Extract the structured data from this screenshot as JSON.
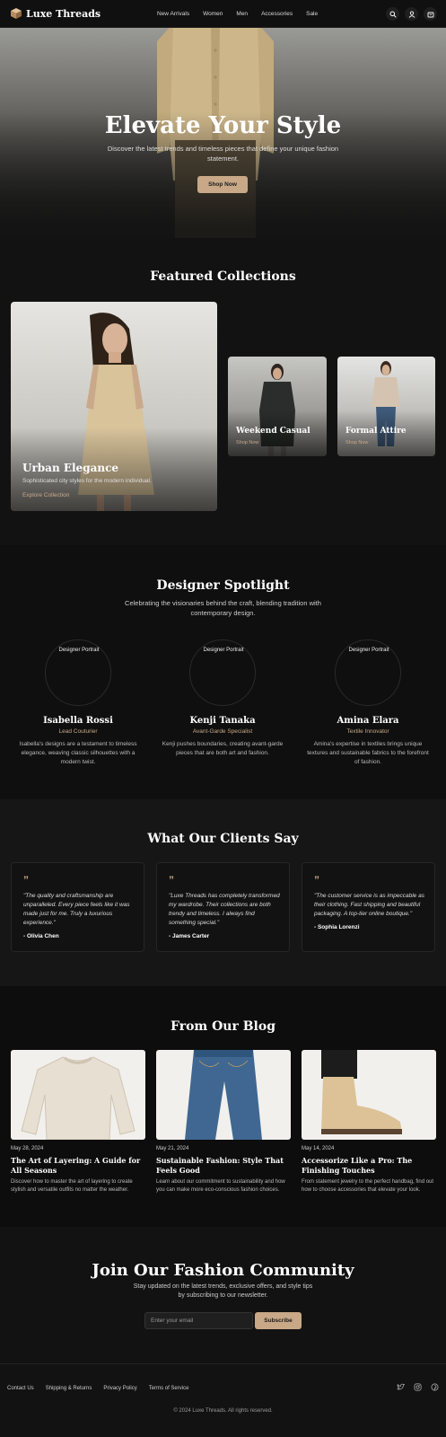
{
  "header": {
    "brand": "Luxe Threads",
    "nav": [
      "New Arrivals",
      "Women",
      "Men",
      "Accessories",
      "Sale"
    ],
    "icons": [
      "search-icon",
      "user-icon",
      "cart-icon"
    ]
  },
  "hero": {
    "title": "Elevate Your Style",
    "subtitle": "Discover the latest trends and timeless pieces that define your unique fashion statement.",
    "cta": "Shop Now"
  },
  "featured": {
    "title": "Featured Collections",
    "cards": [
      {
        "title": "Urban Elegance",
        "subtitle": "Sophisticated city styles for the modern individual.",
        "link": "Explore Collection"
      },
      {
        "title": "Weekend Casual",
        "link": "Shop Now"
      },
      {
        "title": "Formal Attire",
        "link": "Shop Now"
      }
    ]
  },
  "designers": {
    "title": "Designer Spotlight",
    "subtitle": "Celebrating the visionaries behind the craft, blending tradition with contemporary design.",
    "portrait_alt": "Designer Portrait",
    "people": [
      {
        "name": "Isabella Rossi",
        "role": "Lead Couturier",
        "bio": "Isabella's designs are a testament to timeless elegance, weaving classic silhouettes with a modern twist."
      },
      {
        "name": "Kenji Tanaka",
        "role": "Avant-Garde Specialist",
        "bio": "Kenji pushes boundaries, creating avant-garde pieces that are both art and fashion."
      },
      {
        "name": "Amina Elara",
        "role": "Textile Innovator",
        "bio": "Amina's expertise in textiles brings unique textures and sustainable fabrics to the forefront of fashion."
      }
    ]
  },
  "testimonials": {
    "title": "What Our Clients Say",
    "items": [
      {
        "quote": "\"The quality and craftsmanship are unparalleled. Every piece feels like it was made just for me. Truly a luxurious experience.\"",
        "author": "- Olivia Chen"
      },
      {
        "quote": "\"Luxe Threads has completely transformed my wardrobe. Their collections are both trendy and timeless. I always find something special.\"",
        "author": "- James Carter"
      },
      {
        "quote": "\"The customer service is as impeccable as their clothing. Fast shipping and beautiful packaging. A top-tier online boutique.\"",
        "author": "- Sophia Lorenzi"
      }
    ]
  },
  "blog": {
    "title": "From Our Blog",
    "posts": [
      {
        "date": "May 28, 2024",
        "title": "The Art of Layering: A Guide for All Seasons",
        "excerpt": "Discover how to master the art of layering to create stylish and versatile outfits no matter the weather."
      },
      {
        "date": "May 21, 2024",
        "title": "Sustainable Fashion: Style That Feels Good",
        "excerpt": "Learn about our commitment to sustainability and how you can make more eco-conscious fashion choices."
      },
      {
        "date": "May 14, 2024",
        "title": "Accessorize Like a Pro: The Finishing Touches",
        "excerpt": "From statement jewelry to the perfect handbag, find out how to choose accessories that elevate your look."
      }
    ]
  },
  "newsletter": {
    "title": "Join Our Fashion Community",
    "subtitle": "Stay updated on the latest trends, exclusive offers, and style tips by subscribing to our newsletter.",
    "placeholder": "Enter your email",
    "button": "Subscribe"
  },
  "footer": {
    "links": [
      "Contact Us",
      "Shipping & Returns",
      "Privacy Policy",
      "Terms of Service"
    ],
    "social": [
      "twitter-icon",
      "instagram-icon",
      "pinterest-icon"
    ],
    "copyright": "© 2024 Luxe Threads. All rights reserved."
  },
  "colors": {
    "accent": "#c8a887",
    "background": "#121212"
  }
}
